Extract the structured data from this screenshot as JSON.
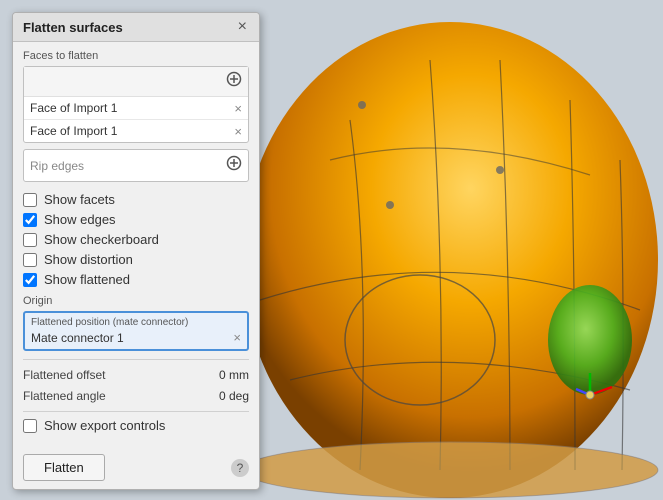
{
  "panel": {
    "title": "Flatten surfaces",
    "close_label": "×",
    "faces_section": {
      "label": "Faces to flatten",
      "faces": [
        {
          "name": "Face of Import 1"
        },
        {
          "name": "Face of Import 1"
        }
      ],
      "add_label": "⊕"
    },
    "rip_edges": {
      "label": "Rip edges",
      "add_label": "⊕"
    },
    "checkboxes": [
      {
        "label": "Show facets",
        "checked": false,
        "id": "cb-facets"
      },
      {
        "label": "Show edges",
        "checked": true,
        "id": "cb-edges"
      },
      {
        "label": "Show checkerboard",
        "checked": false,
        "id": "cb-checker"
      },
      {
        "label": "Show distortion",
        "checked": false,
        "id": "cb-distortion"
      },
      {
        "label": "Show flattened",
        "checked": true,
        "id": "cb-flattened"
      }
    ],
    "origin": {
      "label": "Origin",
      "sublabel": "Flattened position (mate connector)",
      "mate_value": "Mate connector 1",
      "close_label": "×"
    },
    "flattened_offset_label": "Flattened offset",
    "flattened_offset_value": "0 mm",
    "flattened_angle_label": "Flattened angle",
    "flattened_angle_value": "0 deg",
    "show_export_label": "Show export controls",
    "flatten_button": "Flatten",
    "help_label": "?"
  }
}
